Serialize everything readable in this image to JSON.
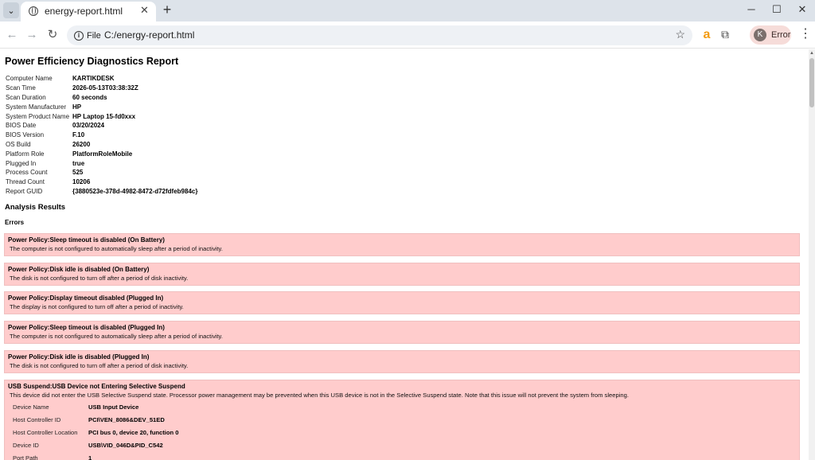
{
  "browser": {
    "tab_title": "energy-report.html",
    "site_chip_label": "File",
    "url": "C:/energy-report.html",
    "profile_initial": "K",
    "profile_label": "Error"
  },
  "report": {
    "title": "Power Efficiency Diagnostics Report",
    "meta": [
      {
        "key": "Computer Name",
        "value": "KARTIKDESK"
      },
      {
        "key": "Scan Time",
        "value": "2026-05-13T03:38:32Z"
      },
      {
        "key": "Scan Duration",
        "value": "60 seconds"
      },
      {
        "key": "System Manufacturer",
        "value": "HP"
      },
      {
        "key": "System Product Name",
        "value": "HP Laptop 15-fd0xxx"
      },
      {
        "key": "BIOS Date",
        "value": "03/20/2024"
      },
      {
        "key": "BIOS Version",
        "value": "F.10"
      },
      {
        "key": "OS Build",
        "value": "26200"
      },
      {
        "key": "Platform Role",
        "value": "PlatformRoleMobile"
      },
      {
        "key": "Plugged In",
        "value": "true"
      },
      {
        "key": "Process Count",
        "value": "525"
      },
      {
        "key": "Thread Count",
        "value": "10206"
      },
      {
        "key": "Report GUID",
        "value": "{3880523e-378d-4982-8472-d72fdfeb984c}"
      }
    ],
    "analysis_heading": "Analysis Results",
    "errors_heading": "Errors",
    "errors": [
      {
        "title": "Power Policy:Sleep timeout is disabled (On Battery)",
        "desc": "The computer is not configured to automatically sleep after a period of inactivity."
      },
      {
        "title": "Power Policy:Disk idle is disabled (On Battery)",
        "desc": "The disk is not configured to turn off after a period of disk inactivity."
      },
      {
        "title": "Power Policy:Display timeout disabled (Plugged In)",
        "desc": "The display is not configured to turn off after a period of inactivity."
      },
      {
        "title": "Power Policy:Sleep timeout is disabled (Plugged In)",
        "desc": "The computer is not configured to automatically sleep after a period of inactivity."
      },
      {
        "title": "Power Policy:Disk idle is disabled (Plugged In)",
        "desc": "The disk is not configured to turn off after a period of disk inactivity."
      }
    ],
    "usb_error": {
      "title": "USB Suspend:USB Device not Entering Selective Suspend",
      "desc": "This device did not enter the USB Selective Suspend state. Processor power management may be prevented when this USB device is not in the Selective Suspend state. Note that this issue will not prevent the system from sleeping.",
      "details": [
        {
          "key": "Device Name",
          "value": "USB Input Device"
        },
        {
          "key": "Host Controller ID",
          "value": "PCI\\VEN_8086&DEV_51ED"
        },
        {
          "key": "Host Controller Location",
          "value": "PCI bus 0, device 20, function 0"
        },
        {
          "key": "Device ID",
          "value": "USB\\VID_046D&PID_C542"
        },
        {
          "key": "Port Path",
          "value": "1"
        }
      ]
    }
  },
  "colors": {
    "error_bg": "#ffcccc",
    "profile_chip_bg": "#f6dcd9"
  }
}
